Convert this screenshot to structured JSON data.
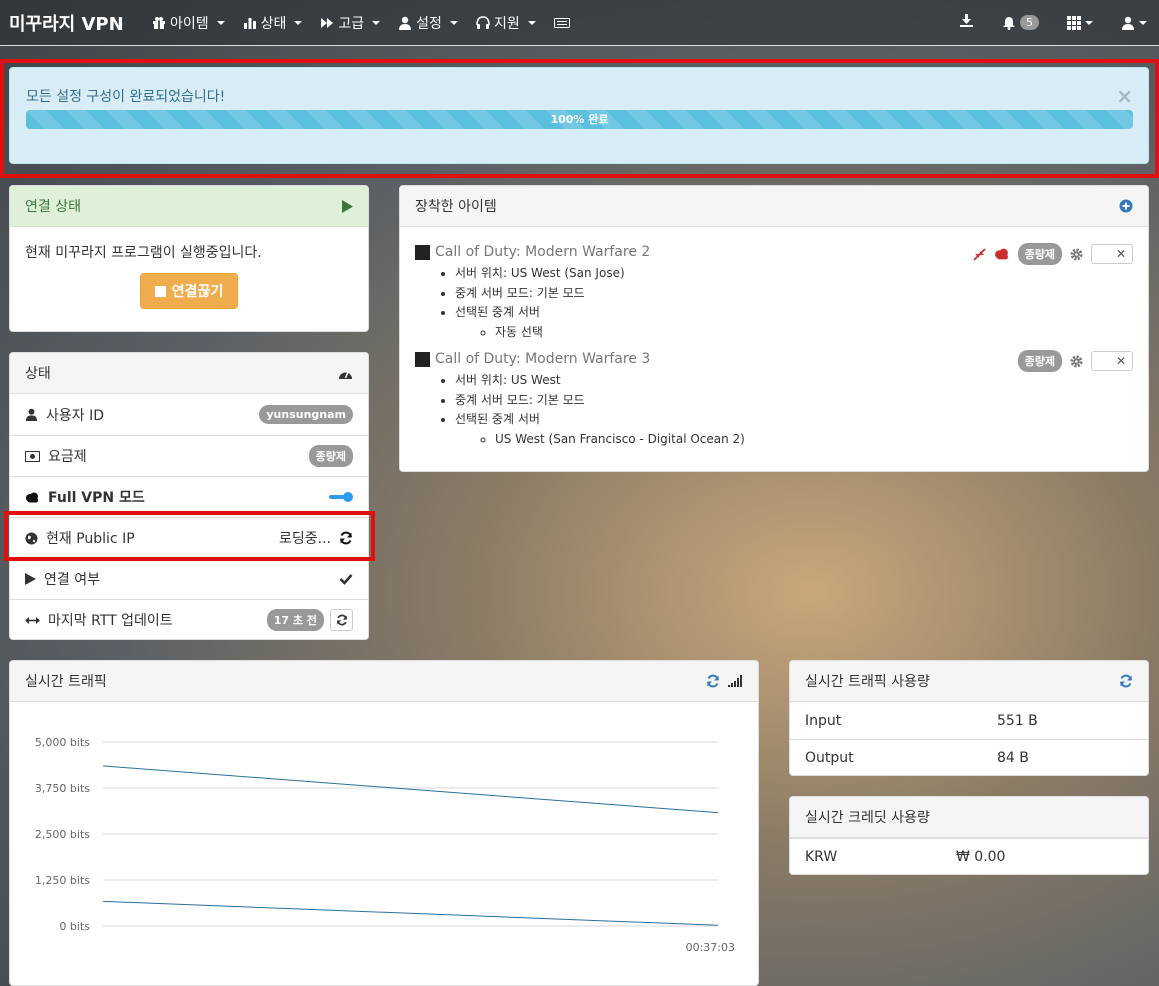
{
  "nav": {
    "brand": "미꾸라지 VPN",
    "items": [
      {
        "label": "아이템"
      },
      {
        "label": "상태"
      },
      {
        "label": "고급"
      },
      {
        "label": "설정"
      },
      {
        "label": "지원"
      }
    ],
    "notification_count": "5"
  },
  "alert": {
    "message": "모든 설정 구성이 완료되었습니다!",
    "progress_label": "100% 완료",
    "progress_fraction": 1.0,
    "close": "×"
  },
  "connection": {
    "title": "연결 상태",
    "message": "현재 미꾸라지 프로그램이 실행중입니다.",
    "disconnect_label": "연결끊기"
  },
  "status": {
    "title": "상태",
    "rows": {
      "user_id_label": "사용자 ID",
      "user_id_value": "yunsungnam",
      "plan_label": "요금제",
      "plan_value": "종량제",
      "full_vpn_label": "Full VPN 모드",
      "full_vpn_on": true,
      "public_ip_label": "현재 Public IP",
      "public_ip_value": "로딩중...",
      "connected_label": "연결 여부",
      "rtt_label": "마지막 RTT 업데이트",
      "rtt_value": "17 초 전"
    }
  },
  "items_panel": {
    "title": "장착한 아이템",
    "games": [
      {
        "name": "Call of Duty: Modern Warfare 2",
        "plan": "종량제",
        "details": [
          "서버 위치: US West (San Jose)",
          "중계 서버 모드: 기본 모드",
          "선택된 중계 서버"
        ],
        "relay": "자동 선택"
      },
      {
        "name": "Call of Duty: Modern Warfare 3",
        "plan": "종량제",
        "details": [
          "서버 위치: US West",
          "중계 서버 모드: 기본 모드",
          "선택된 중계 서버"
        ],
        "relay": "US West (San Francisco - Digital Ocean 2)"
      }
    ]
  },
  "traffic": {
    "title": "실시간 트래픽",
    "time_label": "00:37:03"
  },
  "chart_data": {
    "type": "line",
    "y_ticks": [
      "5,000 bits",
      "3,750 bits",
      "2,500 bits",
      "1,250 bits",
      "0 bits"
    ],
    "ylim": [
      0,
      5000
    ],
    "x": [
      "",
      "00:37:03"
    ],
    "series": [
      {
        "values": [
          4350,
          3080
        ]
      },
      {
        "values": [
          670,
          20
        ]
      }
    ],
    "grid": true
  },
  "traffic_usage": {
    "title": "실시간 트래픽 사용량",
    "rows": [
      {
        "k": "Input",
        "v": "551 B"
      },
      {
        "k": "Output",
        "v": "84 B"
      }
    ]
  },
  "credit_usage": {
    "title": "실시간 크레딧 사용량",
    "rows": [
      {
        "k": "KRW",
        "v": "₩ 0.00"
      }
    ]
  }
}
